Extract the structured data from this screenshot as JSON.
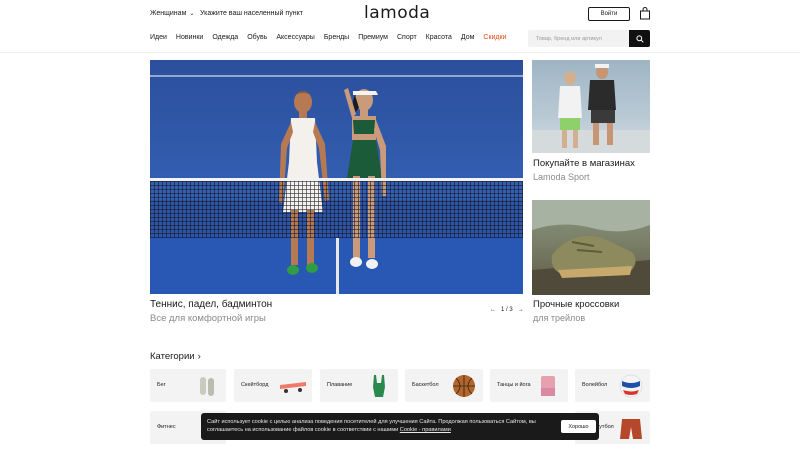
{
  "header": {
    "gender_label": "Женщинам",
    "location_label": "Укажите ваш населенный пункт",
    "logo": "lamoda",
    "login_label": "Войти",
    "cart_icon": "shopping-bag-icon"
  },
  "nav": {
    "items": [
      "Идеи",
      "Новинки",
      "Одежда",
      "Обувь",
      "Аксессуары",
      "Бренды",
      "Премиум",
      "Спорт",
      "Красота",
      "Дом",
      "Скидки"
    ],
    "sale_color": "#e04b1a"
  },
  "search": {
    "placeholder": "Товар, бренд или артикул"
  },
  "hero": {
    "title": "Теннис, падел, бадминтон",
    "subtitle": "Все для комфортной игры",
    "pager": "1 / 3"
  },
  "promos": [
    {
      "title": "Покупайте в магазинах",
      "subtitle": "Lamoda Sport"
    },
    {
      "title": "Прочные кроссовки",
      "subtitle": "для трейлов"
    }
  ],
  "categories": {
    "heading": "Категории",
    "row1": [
      "Бег",
      "Скейтборд",
      "Плавание",
      "Баскетбол",
      "Танцы и йога",
      "Волейбол"
    ],
    "row2": [
      "Фитнес",
      "",
      "",
      "",
      "",
      "Футбол"
    ]
  },
  "cookie": {
    "text_part1": "Сайт использует cookie с целью анализа поведения посетителей для улучшения Сайта. Продолжая пользоваться Сайтом, вы соглашаетесь на использование файлов cookie в соответствии с нашими ",
    "link": "Cookie - правилами",
    "accept_label": "Хорошо"
  }
}
